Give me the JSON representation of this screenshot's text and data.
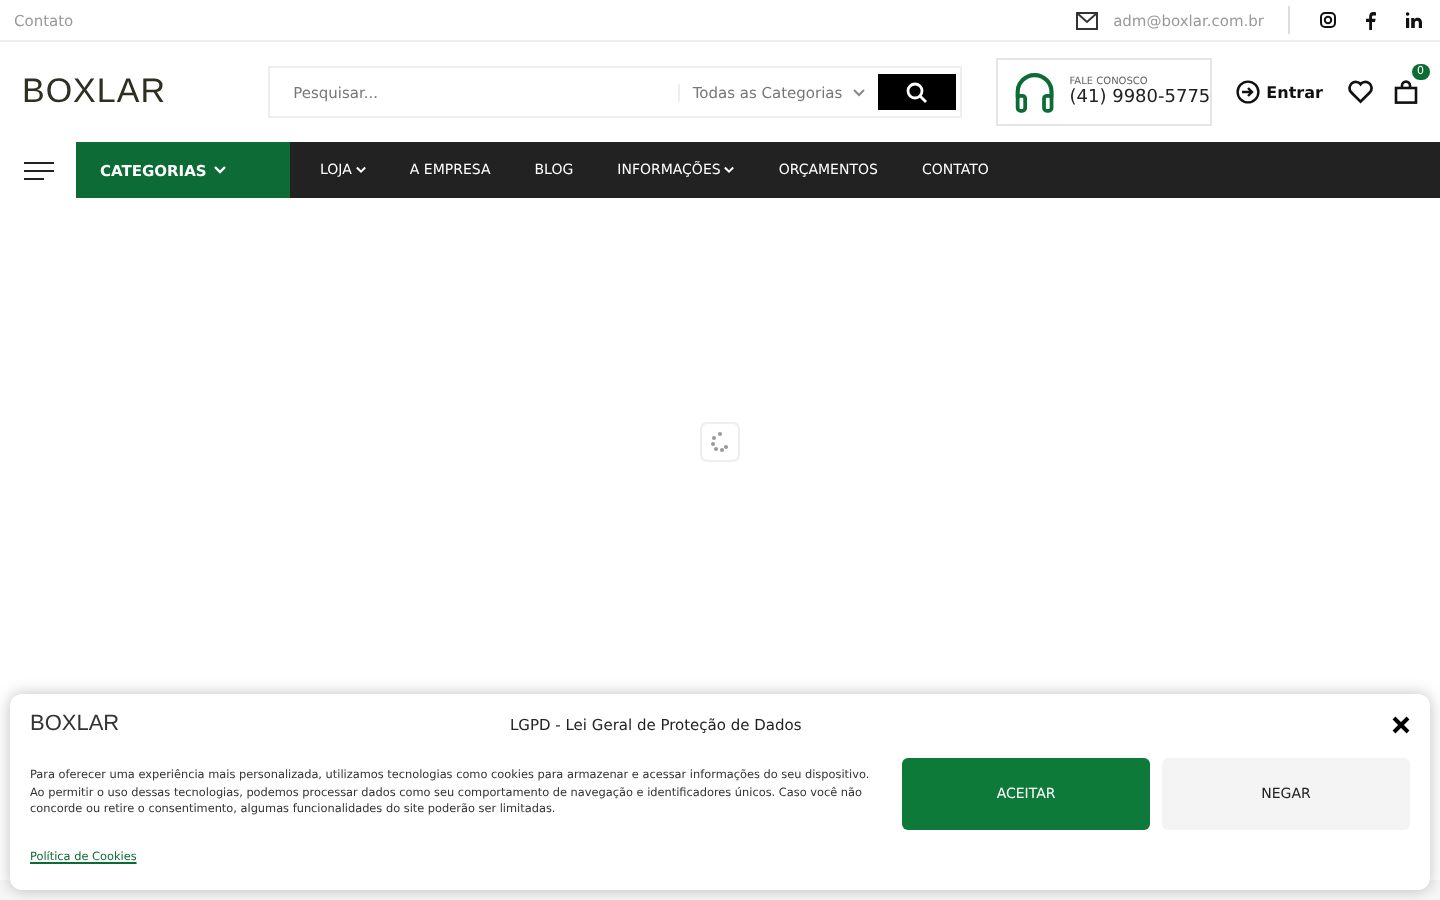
{
  "topbar": {
    "link": "Contato",
    "email": "adm@boxlar.com.br"
  },
  "header": {
    "logo": "BOXLAR",
    "search": {
      "placeholder": "Pesquisar...",
      "category": "Todas as Categorias"
    },
    "contact": {
      "label": "FALE CONOSCO",
      "phone": "(41) 9980-5775"
    },
    "login": "Entrar",
    "cart_count": "0"
  },
  "nav": {
    "categories": "CATEGORIAS",
    "items": [
      {
        "label": "LOJA",
        "dropdown": true
      },
      {
        "label": "A EMPRESA",
        "dropdown": false
      },
      {
        "label": "BLOG",
        "dropdown": false
      },
      {
        "label": "INFORMAÇÕES",
        "dropdown": true
      },
      {
        "label": "ORÇAMENTOS",
        "dropdown": false
      },
      {
        "label": "CONTATO",
        "dropdown": false
      }
    ]
  },
  "cookie_banner": {
    "logo": "BOXLAR",
    "title": "LGPD - Lei Geral de Proteção de Dados",
    "text": "Para oferecer uma experiência mais personalizada, utilizamos tecnologias como cookies para armazenar e acessar informações do seu dispositivo. Ao permitir o uso dessas tecnologias, podemos processar dados como seu comportamento de navegação e identificadores únicos. Caso você não concorde ou retire o consentimento, algumas funcionalidades do site poderão ser limitadas.",
    "policy_link": "Política de Cookies",
    "buttons": [
      {
        "label": "ACEITAR",
        "kind": "primary"
      },
      {
        "label": "NEGAR",
        "kind": "secondary"
      }
    ]
  }
}
